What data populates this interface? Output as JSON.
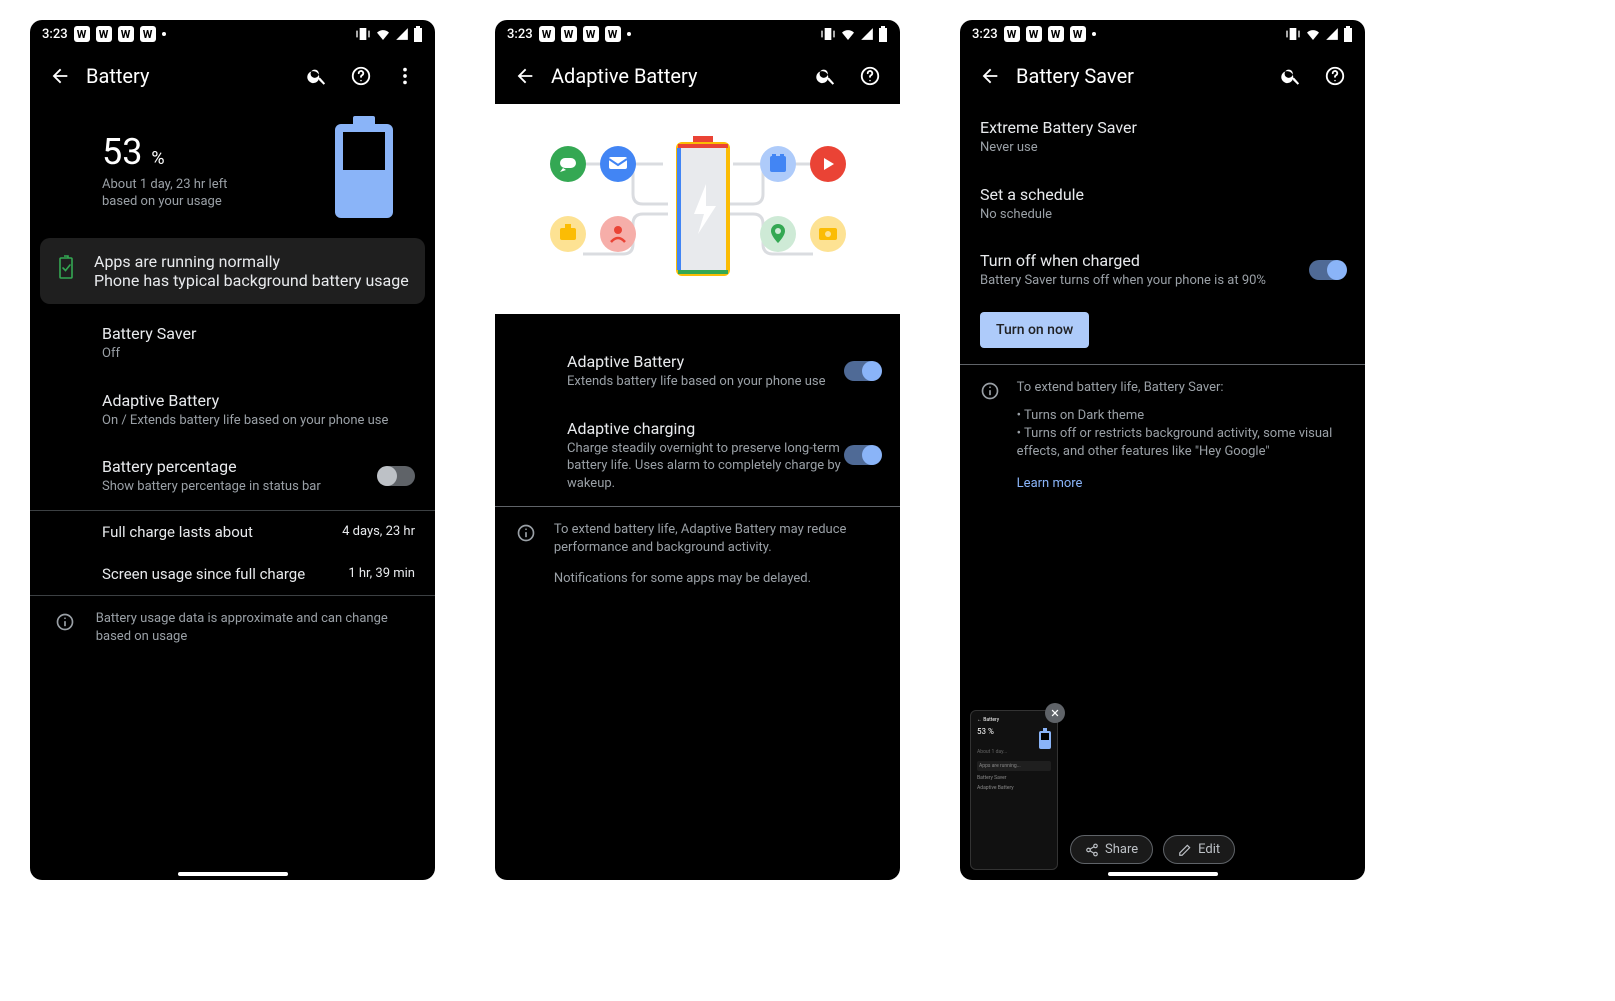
{
  "status": {
    "time": "3:23",
    "w_count": 4
  },
  "screen1": {
    "title": "Battery",
    "percent_num": "53",
    "percent_sign": "%",
    "estimate_l1": "About 1 day, 23 hr left",
    "estimate_l2": "based on your usage",
    "apps_card": {
      "title": "Apps are running normally",
      "sub": "Phone has typical background battery usage"
    },
    "battery_saver": {
      "title": "Battery Saver",
      "sub": "Off"
    },
    "adaptive": {
      "title": "Adaptive Battery",
      "sub": "On / Extends battery life based on your phone use"
    },
    "percentage": {
      "title": "Battery percentage",
      "sub": "Show battery percentage in status bar"
    },
    "stat1": {
      "label": "Full charge lasts about",
      "val": "4 days, 23 hr"
    },
    "stat2": {
      "label": "Screen usage since full charge",
      "val": "1 hr, 39 min"
    },
    "info": "Battery usage data is approximate and can change based on usage"
  },
  "screen2": {
    "title": "Adaptive Battery",
    "opt1": {
      "title": "Adaptive Battery",
      "sub": "Extends battery life based on your phone use"
    },
    "opt2": {
      "title": "Adaptive charging",
      "sub": "Charge steadily overnight to preserve long-term battery life. Uses alarm to completely charge by wakeup."
    },
    "info_l1": "To extend battery life, Adaptive Battery may reduce performance and background activity.",
    "info_l2": "Notifications for some apps may be delayed."
  },
  "screen3": {
    "title": "Battery Saver",
    "extreme": {
      "title": "Extreme Battery Saver",
      "sub": "Never use"
    },
    "schedule": {
      "title": "Set a schedule",
      "sub": "No schedule"
    },
    "turnoff": {
      "title": "Turn off when charged",
      "sub": "Battery Saver turns off when your phone is at 90%"
    },
    "btn": "Turn on now",
    "info_head": "To extend battery life, Battery Saver:",
    "info_b1": "• Turns on Dark theme",
    "info_b2": "• Turns off or restricts background activity, some visual effects, and other features like \"Hey Google\"",
    "learn": "Learn more",
    "share": "Share",
    "edit": "Edit"
  }
}
